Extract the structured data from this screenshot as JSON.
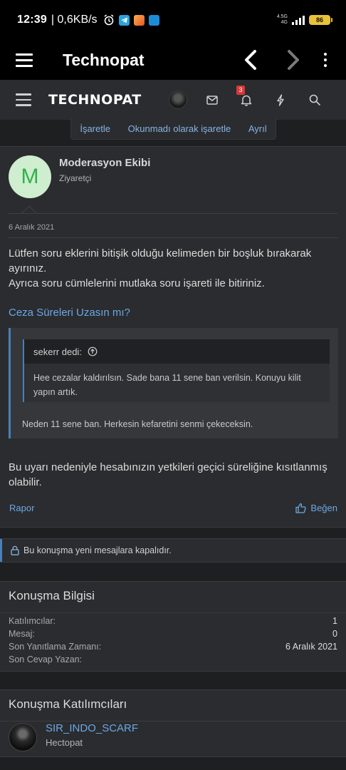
{
  "status_bar": {
    "time": "12:39",
    "speed": "| 0,6KB/s",
    "network": "4.5G",
    "network_sub": "4G",
    "battery": "86"
  },
  "app_bar": {
    "title": "Technopat",
    "icons": [
      "menu-icon",
      "back-arrow-icon",
      "forward-arrow-icon",
      "more-vert-icon"
    ]
  },
  "site_header": {
    "logo": "TECHNOPAT",
    "notification_count": "3",
    "icons": [
      "hamburger-icon",
      "mail-icon",
      "bell-icon",
      "bolt-icon",
      "search-icon"
    ]
  },
  "action_bar": {
    "mark": "İşaretle",
    "mark_unread": "Okunmadı olarak işaretle",
    "leave": "Ayrıl"
  },
  "message": {
    "avatar_letter": "M",
    "username": "Moderasyon Ekibi",
    "role": "Ziyaretçi",
    "date": "6 Aralık 2021",
    "body_line1": "Lütfen soru eklerini bitişik olduğu kelimeden bir boşluk bırakarak ayırınız.",
    "body_line2": "Ayrıca soru cümlelerini mutlaka soru işareti ile bitiriniz.",
    "link": "Ceza Süreleri Uzasın mı?",
    "quote": {
      "author": "sekerr dedi:",
      "inner_text": "Hee cezalar kaldırılsın. Sade bana 11 sene ban verilsin. Konuyu kilit yapın artık.",
      "reply": "Neden 11 sene ban. Herkesin kefaretini senmi çekeceksin."
    },
    "warning": "Bu uyarı nedeniyle hesabınızın yetkileri geçici süreliğine kısıtlanmış olabilir.",
    "report": "Rapor",
    "like": "Beğen"
  },
  "locked_notice": "Bu konuşma yeni mesajlara kapalıdır.",
  "info": {
    "title": "Konuşma Bilgisi",
    "rows": [
      {
        "label": "Katılımcılar:",
        "value": "1"
      },
      {
        "label": "Mesaj:",
        "value": "0"
      },
      {
        "label": "Son Yanıtlama Zamanı:",
        "value": "6 Aralık 2021"
      },
      {
        "label": "Son Cevap Yazan:",
        "value": ""
      }
    ]
  },
  "participants": {
    "title": "Konuşma Katılımcıları",
    "items": [
      {
        "name": "SIR_INDO_SCARF",
        "role": "Hectopat"
      }
    ]
  },
  "colors": {
    "link": "#6aa8e6",
    "accent": "#4a7fb8",
    "panel": "#2b2c2f",
    "background": "#1e1f21",
    "avatar_bg": "#cfeecf",
    "avatar_fg": "#2fb24b",
    "badge": "#d93838"
  }
}
